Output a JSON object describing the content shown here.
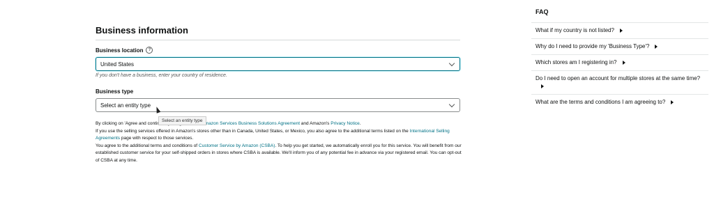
{
  "form": {
    "section_title": "Business information",
    "business_location_label": "Business location",
    "business_location_value": "United States",
    "business_location_hint": "If you don't have a business, enter your country of residence.",
    "business_type_label": "Business type",
    "business_type_value": "Select an entity type",
    "tooltip": "Select an entity type"
  },
  "legal": {
    "p1_a": "By clicking on 'Agree and continue', you agree to the ",
    "p1_link1": "Amazon Services Business Solutions Agreement",
    "p1_b": " and Amazon's ",
    "p1_link2": "Privacy Notice",
    "p1_c": ".",
    "p2_a": "If you use the selling services offered in Amazon's stores other than in Canada, United States, or Mexico, you also agree to the additional terms listed on the ",
    "p2_link": "International Selling Agreements",
    "p2_b": " page with respect to those services.",
    "p3_a": "You agree to the additional terms and conditions of ",
    "p3_link": "Customer Service by Amazon (CSBA)",
    "p3_b": ". To help you get started, we automatically enroll you for this service. You will benefit from our established customer service for your self-shipped orders in stores where CSBA is available. We'll inform you of any potential fee in advance via your registered email. You can opt-out of CSBA at any time."
  },
  "faq": {
    "title": "FAQ",
    "items": [
      "What if my country is not listed?",
      "Why do I need to provide my 'Business Type'?",
      "Which stores am I registering in?",
      "Do I need to open an account for multiple stores at the same time?",
      "What are the terms and conditions I am agreeing to?"
    ]
  },
  "colors": {
    "link": "#007185",
    "focus_border": "#007185"
  }
}
